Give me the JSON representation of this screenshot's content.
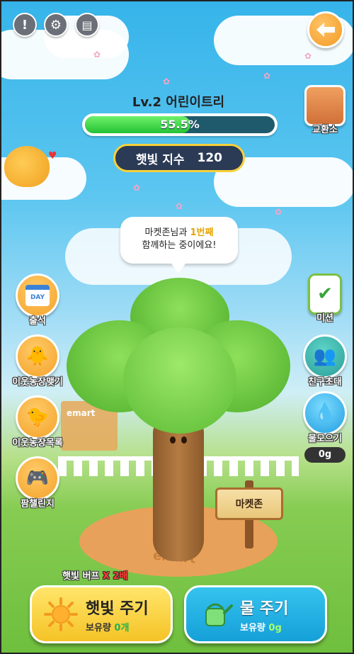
{
  "top_bar": {
    "info_icon": "exclamation-icon",
    "settings_icon": "gear-icon",
    "guide_icon": "book-icon",
    "back_icon": "back-arrow-icon"
  },
  "tree_status": {
    "level_label": "Lv.2 어린이트리",
    "progress_text": "55.5%",
    "progress_fraction": 0.555,
    "sun_index_label": "햇빛 지수",
    "sun_index_value": "120"
  },
  "speech_bubble": {
    "line1_prefix": "마켓존님과 ",
    "line1_highlight": "1번째",
    "line2": "함께하는 중이에요!"
  },
  "left_menu": [
    {
      "label": "출석",
      "icon": "calendar-day-icon"
    },
    {
      "label": "이웃농장맺기",
      "icon": "neighbor-characters-icon"
    },
    {
      "label": "이웃농장목록",
      "icon": "character-icon"
    },
    {
      "label": "팜챌린지",
      "icon": "gamepad-icon"
    }
  ],
  "right_menu": [
    {
      "label": "교환소",
      "icon": "store-building-icon"
    },
    {
      "label": "미션",
      "icon": "checklist-icon"
    },
    {
      "label": "친구초대",
      "icon": "friends-icon"
    },
    {
      "label": "물모으기",
      "icon": "water-drop-icon",
      "value": "0g"
    }
  ],
  "scene": {
    "sign_text": "마켓존",
    "ground_logo": "emart",
    "store_logo": "emart"
  },
  "buff": {
    "prefix": "햇빛 버프 ",
    "multiplier": "X 2배"
  },
  "actions": {
    "sun": {
      "title": "햇빛 주기",
      "sub_label": "보유량 ",
      "qty": "0개",
      "icon": "sun-icon"
    },
    "water": {
      "title": "물 주기",
      "sub_label": "보유량 ",
      "qty": "0g",
      "icon": "watering-can-icon"
    }
  },
  "colors": {
    "accent_orange": "#f4a228",
    "progress_green": "#24c235",
    "sun_yellow": "#f5c327",
    "water_blue": "#15a0d8"
  }
}
